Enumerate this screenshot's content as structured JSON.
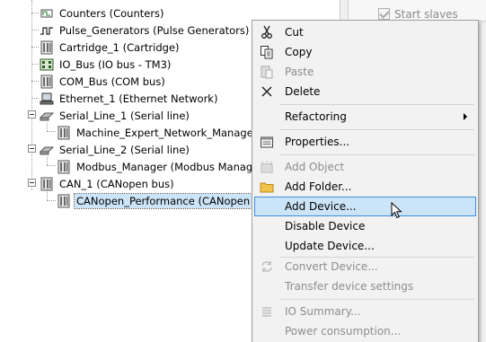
{
  "tree": {
    "items": [
      {
        "label": "Counters (Counters)"
      },
      {
        "label": "Pulse_Generators (Pulse Generators)"
      },
      {
        "label": "Cartridge_1 (Cartridge)"
      },
      {
        "label": "IO_Bus (IO bus - TM3)"
      },
      {
        "label": "COM_Bus (COM bus)"
      },
      {
        "label": "Ethernet_1 (Ethernet Network)"
      },
      {
        "label": "Serial_Line_1 (Serial line)"
      },
      {
        "label": "Machine_Expert_Network_Manager (Mac"
      },
      {
        "label": "Serial_Line_2 (Serial line)"
      },
      {
        "label": "Modbus_Manager (Modbus Manager)"
      },
      {
        "label": "CAN_1 (CANopen bus)"
      },
      {
        "label": "CANopen_Performance (CANopen Perfor"
      }
    ]
  },
  "right_panel": {
    "checkbox_label": "Start slaves",
    "checkbox_checked": true
  },
  "context_menu": {
    "items": [
      {
        "label": "Cut",
        "icon": "scissors-icon",
        "enabled": true
      },
      {
        "label": "Copy",
        "icon": "copy-icon",
        "enabled": true
      },
      {
        "label": "Paste",
        "icon": "paste-icon",
        "enabled": false
      },
      {
        "label": "Delete",
        "icon": "delete-icon",
        "enabled": true
      },
      {
        "label": "Refactoring",
        "icon": "",
        "enabled": true,
        "submenu": true
      },
      {
        "label": "Properties...",
        "icon": "properties-icon",
        "enabled": true
      },
      {
        "label": "Add Object",
        "icon": "add-object-icon",
        "enabled": false
      },
      {
        "label": "Add Folder...",
        "icon": "folder-icon",
        "enabled": true
      },
      {
        "label": "Add Device...",
        "icon": "",
        "enabled": true,
        "highlighted": true
      },
      {
        "label": "Disable Device",
        "icon": "",
        "enabled": true
      },
      {
        "label": "Update Device...",
        "icon": "",
        "enabled": true
      },
      {
        "label": "Convert Device...",
        "icon": "convert-icon",
        "enabled": false
      },
      {
        "label": "Transfer device settings",
        "icon": "",
        "enabled": false
      },
      {
        "label": "IO Summary...",
        "icon": "io-summary-icon",
        "enabled": false
      },
      {
        "label": "Power consumption...",
        "icon": "",
        "enabled": false
      }
    ]
  },
  "colors": {
    "menu_highlight": "#cce4f7",
    "menu_highlight_border": "#3c8ee0",
    "disabled_text": "#8d8d8d",
    "selection": "#cce4f7"
  }
}
